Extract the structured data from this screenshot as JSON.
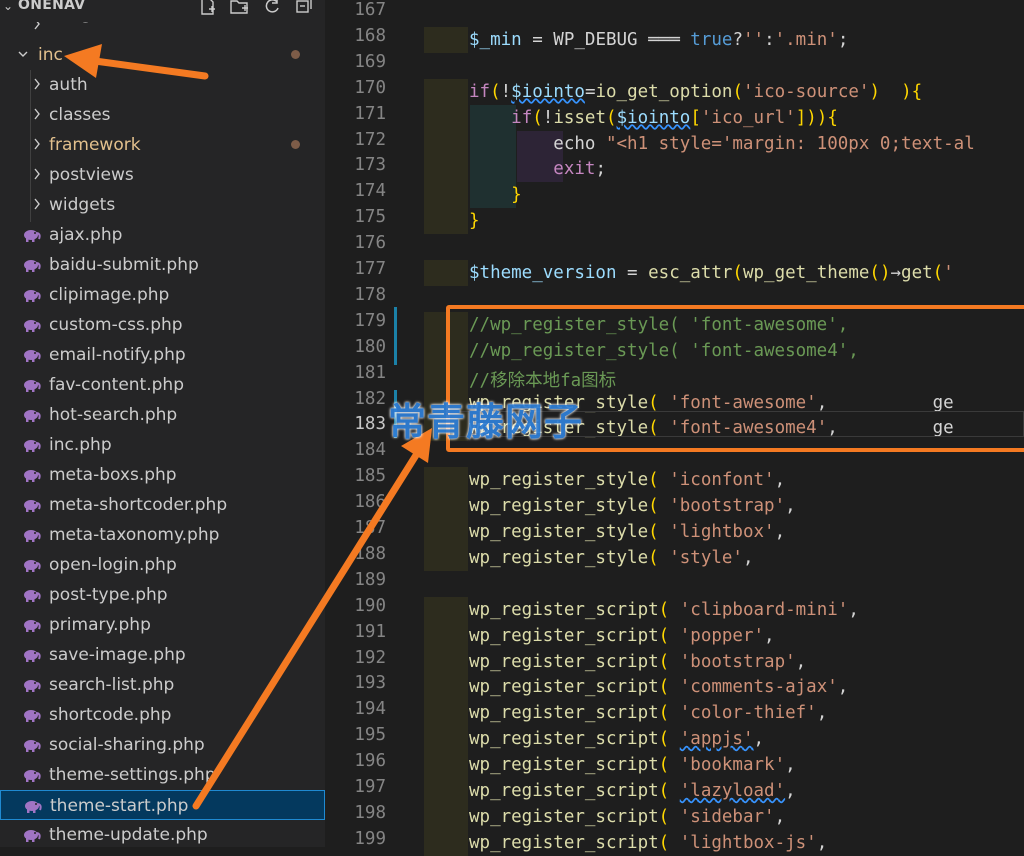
{
  "sidebar": {
    "title": "ONENAV",
    "header_icons": [
      "new-file-icon",
      "new-folder-icon",
      "refresh-icon",
      "collapse-all-icon"
    ],
    "items": [
      {
        "label": "images",
        "type": "folder",
        "depth": 1,
        "expanded": false,
        "partial": true
      },
      {
        "label": "inc",
        "type": "folder",
        "depth": 0,
        "expanded": true,
        "modified": true
      },
      {
        "label": "auth",
        "type": "folder",
        "depth": 1,
        "expanded": false
      },
      {
        "label": "classes",
        "type": "folder",
        "depth": 1,
        "expanded": false
      },
      {
        "label": "framework",
        "type": "folder",
        "depth": 1,
        "expanded": false,
        "modified": true
      },
      {
        "label": "postviews",
        "type": "folder",
        "depth": 1,
        "expanded": false
      },
      {
        "label": "widgets",
        "type": "folder",
        "depth": 1,
        "expanded": false
      },
      {
        "label": "ajax.php",
        "type": "php"
      },
      {
        "label": "baidu-submit.php",
        "type": "php"
      },
      {
        "label": "clipimage.php",
        "type": "php"
      },
      {
        "label": "custom-css.php",
        "type": "php"
      },
      {
        "label": "email-notify.php",
        "type": "php"
      },
      {
        "label": "fav-content.php",
        "type": "php"
      },
      {
        "label": "hot-search.php",
        "type": "php"
      },
      {
        "label": "inc.php",
        "type": "php"
      },
      {
        "label": "meta-boxs.php",
        "type": "php"
      },
      {
        "label": "meta-shortcoder.php",
        "type": "php"
      },
      {
        "label": "meta-taxonomy.php",
        "type": "php"
      },
      {
        "label": "open-login.php",
        "type": "php"
      },
      {
        "label": "post-type.php",
        "type": "php"
      },
      {
        "label": "primary.php",
        "type": "php"
      },
      {
        "label": "save-image.php",
        "type": "php"
      },
      {
        "label": "search-list.php",
        "type": "php"
      },
      {
        "label": "shortcode.php",
        "type": "php"
      },
      {
        "label": "social-sharing.php",
        "type": "php"
      },
      {
        "label": "theme-settings.php",
        "type": "php"
      },
      {
        "label": "theme-start.php",
        "type": "php",
        "selected": true
      },
      {
        "label": "theme-update.php",
        "type": "php"
      }
    ]
  },
  "editor": {
    "active_line": 183,
    "lines": [
      {
        "n": 167,
        "tokens": []
      },
      {
        "n": 168,
        "tokens": [
          [
            "var",
            "$_min"
          ],
          [
            "plain",
            " = WP_DEBUG "
          ],
          [
            "plain",
            "═══ "
          ],
          [
            "bl",
            "true"
          ],
          [
            "plain",
            "?"
          ],
          [
            "str",
            "''"
          ],
          [
            "plain",
            ":"
          ],
          [
            "str",
            "'.min'"
          ],
          [
            "plain",
            ";"
          ]
        ]
      },
      {
        "n": 169,
        "tokens": []
      },
      {
        "n": 170,
        "tokens": [
          [
            "kw",
            "if"
          ],
          [
            "punc",
            "("
          ],
          [
            "plain",
            "!"
          ],
          [
            "var sq",
            "$iointo"
          ],
          [
            "plain",
            "="
          ],
          [
            "fn",
            "io_get_option"
          ],
          [
            "punc",
            "("
          ],
          [
            "str",
            "'ico-source'"
          ],
          [
            "punc",
            ")"
          ],
          [
            "plain",
            "  "
          ],
          [
            "punc",
            "){"
          ]
        ]
      },
      {
        "n": 171,
        "tokens": [
          [
            "plain",
            "    "
          ],
          [
            "kw",
            "if"
          ],
          [
            "punc",
            "("
          ],
          [
            "plain",
            "!"
          ],
          [
            "fn",
            "isset"
          ],
          [
            "punc",
            "("
          ],
          [
            "var sq",
            "$iointo"
          ],
          [
            "punc",
            "["
          ],
          [
            "str",
            "'ico_url'"
          ],
          [
            "punc",
            "]"
          ],
          [
            "punc",
            "))"
          ],
          [
            "punc",
            "{"
          ]
        ]
      },
      {
        "n": 172,
        "tokens": [
          [
            "plain",
            "        echo "
          ],
          [
            "str",
            "\"<h1 style='margin: 100px 0;text-al"
          ]
        ]
      },
      {
        "n": 173,
        "tokens": [
          [
            "plain",
            "        "
          ],
          [
            "kw",
            "exit"
          ],
          [
            "plain",
            ";"
          ]
        ]
      },
      {
        "n": 174,
        "tokens": [
          [
            "plain",
            "    "
          ],
          [
            "punc",
            "}"
          ]
        ]
      },
      {
        "n": 175,
        "tokens": [
          [
            "punc",
            "}"
          ]
        ]
      },
      {
        "n": 176,
        "tokens": []
      },
      {
        "n": 177,
        "tokens": [
          [
            "var",
            "$theme_version"
          ],
          [
            "plain",
            " = "
          ],
          [
            "fn",
            "esc_attr"
          ],
          [
            "punc",
            "("
          ],
          [
            "fn",
            "wp_get_theme"
          ],
          [
            "punc",
            "()"
          ],
          [
            "plain",
            "→"
          ],
          [
            "fn",
            "get"
          ],
          [
            "punc",
            "("
          ],
          [
            "str",
            "'"
          ]
        ]
      },
      {
        "n": 178,
        "tokens": []
      },
      {
        "n": 179,
        "tokens": [
          [
            "cm",
            "//wp_register_style( 'font-awesome',"
          ]
        ]
      },
      {
        "n": 180,
        "tokens": [
          [
            "cm",
            "//wp_register_style( 'font-awesome4',"
          ]
        ]
      },
      {
        "n": 181,
        "tokens": [
          [
            "cm",
            "//移除本地fa图标"
          ]
        ]
      },
      {
        "n": 182,
        "tokens": [
          [
            "fn",
            "wp_register_style"
          ],
          [
            "punc",
            "("
          ],
          [
            "plain",
            " "
          ],
          [
            "str",
            "'font-awesome'"
          ],
          [
            "plain",
            ",          ge"
          ]
        ]
      },
      {
        "n": 183,
        "tokens": [
          [
            "fn",
            "wp_register_style"
          ],
          [
            "punc",
            "("
          ],
          [
            "plain",
            " "
          ],
          [
            "str",
            "'font-awesome4'"
          ],
          [
            "plain",
            ",         ge"
          ]
        ]
      },
      {
        "n": 184,
        "tokens": []
      },
      {
        "n": 185,
        "tokens": [
          [
            "fn",
            "wp_register_style"
          ],
          [
            "punc",
            "("
          ],
          [
            "plain",
            " "
          ],
          [
            "str",
            "'iconfont'"
          ],
          [
            "plain",
            ","
          ]
        ]
      },
      {
        "n": 186,
        "tokens": [
          [
            "fn",
            "wp_register_style"
          ],
          [
            "punc",
            "("
          ],
          [
            "plain",
            " "
          ],
          [
            "str",
            "'bootstrap'"
          ],
          [
            "plain",
            ","
          ]
        ]
      },
      {
        "n": 187,
        "tokens": [
          [
            "fn",
            "wp_register_style"
          ],
          [
            "punc",
            "("
          ],
          [
            "plain",
            " "
          ],
          [
            "str",
            "'lightbox'"
          ],
          [
            "plain",
            ","
          ]
        ]
      },
      {
        "n": 188,
        "tokens": [
          [
            "fn",
            "wp_register_style"
          ],
          [
            "punc",
            "("
          ],
          [
            "plain",
            " "
          ],
          [
            "str",
            "'style'"
          ],
          [
            "plain",
            ","
          ]
        ]
      },
      {
        "n": 189,
        "tokens": []
      },
      {
        "n": 190,
        "tokens": [
          [
            "fn",
            "wp_register_script"
          ],
          [
            "punc",
            "("
          ],
          [
            "plain",
            " "
          ],
          [
            "str",
            "'clipboard-mini'"
          ],
          [
            "plain",
            ","
          ]
        ]
      },
      {
        "n": 191,
        "tokens": [
          [
            "fn",
            "wp_register_script"
          ],
          [
            "punc",
            "("
          ],
          [
            "plain",
            " "
          ],
          [
            "str",
            "'popper'"
          ],
          [
            "plain",
            ","
          ]
        ]
      },
      {
        "n": 192,
        "tokens": [
          [
            "fn",
            "wp_register_script"
          ],
          [
            "punc",
            "("
          ],
          [
            "plain",
            " "
          ],
          [
            "str",
            "'bootstrap'"
          ],
          [
            "plain",
            ","
          ]
        ]
      },
      {
        "n": 193,
        "tokens": [
          [
            "fn",
            "wp_register_script"
          ],
          [
            "punc",
            "("
          ],
          [
            "plain",
            " "
          ],
          [
            "str",
            "'comments-ajax'"
          ],
          [
            "plain",
            ","
          ]
        ]
      },
      {
        "n": 194,
        "tokens": [
          [
            "fn",
            "wp_register_script"
          ],
          [
            "punc",
            "("
          ],
          [
            "plain",
            " "
          ],
          [
            "str",
            "'color-thief'"
          ],
          [
            "plain",
            ","
          ]
        ]
      },
      {
        "n": 195,
        "tokens": [
          [
            "fn",
            "wp_register_script"
          ],
          [
            "punc",
            "("
          ],
          [
            "plain",
            " "
          ],
          [
            "str sq",
            "'appjs'"
          ],
          [
            "plain",
            ","
          ]
        ]
      },
      {
        "n": 196,
        "tokens": [
          [
            "fn",
            "wp_register_script"
          ],
          [
            "punc",
            "("
          ],
          [
            "plain",
            " "
          ],
          [
            "str",
            "'bookmark'"
          ],
          [
            "plain",
            ","
          ]
        ]
      },
      {
        "n": 197,
        "tokens": [
          [
            "fn",
            "wp_register_script"
          ],
          [
            "punc",
            "("
          ],
          [
            "plain",
            " "
          ],
          [
            "str sq",
            "'lazyload'"
          ],
          [
            "plain",
            ","
          ]
        ]
      },
      {
        "n": 198,
        "tokens": [
          [
            "fn",
            "wp_register_script"
          ],
          [
            "punc",
            "("
          ],
          [
            "plain",
            " "
          ],
          [
            "str",
            "'sidebar'"
          ],
          [
            "plain",
            ","
          ]
        ]
      },
      {
        "n": 199,
        "tokens": [
          [
            "fn",
            "wp_register_script"
          ],
          [
            "punc",
            "("
          ],
          [
            "plain",
            " "
          ],
          [
            "str",
            "'lightbox-js'"
          ],
          [
            "plain",
            ","
          ]
        ]
      }
    ]
  },
  "watermark": "常青藤网子",
  "colors": {
    "annotation": "#f47a22",
    "selection": "#04395e",
    "watermark": "#2f7fd8"
  }
}
